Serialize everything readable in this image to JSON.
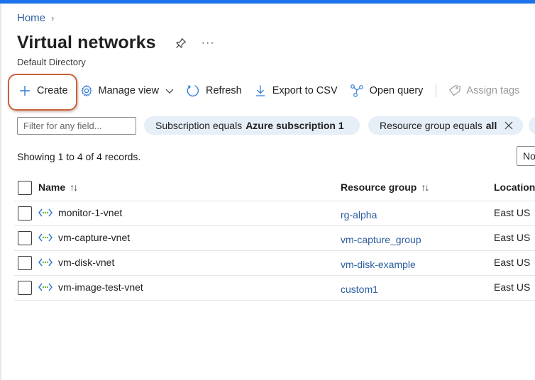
{
  "breadcrumb": {
    "home": "Home",
    "separator": "›"
  },
  "header": {
    "title": "Virtual networks",
    "subtitle": "Default Directory",
    "more": "···"
  },
  "toolbar": {
    "create": "Create",
    "manage_view": "Manage view",
    "refresh": "Refresh",
    "export_csv": "Export to CSV",
    "open_query": "Open query",
    "assign_tags": "Assign tags"
  },
  "filters": {
    "placeholder": "Filter for any field...",
    "subscription_prefix": "Subscription equals",
    "subscription_value": "Azure subscription 1",
    "rg_prefix": "Resource group equals",
    "rg_value": "all"
  },
  "records_text": "Showing 1 to 4 of 4 records.",
  "view_select_partial": "No",
  "table": {
    "columns": {
      "name": "Name",
      "resource_group": "Resource group",
      "location": "Location",
      "sort_glyph": "↑↓"
    },
    "rows": [
      {
        "name": "monitor-1-vnet",
        "resource_group": "rg-alpha",
        "location": "East US"
      },
      {
        "name": "vm-capture-vnet",
        "resource_group": "vm-capture_group",
        "location": "East US"
      },
      {
        "name": "vm-disk-vnet",
        "resource_group": "vm-disk-example",
        "location": "East US"
      },
      {
        "name": "vm-image-test-vnet",
        "resource_group": "custom1",
        "location": "East US"
      }
    ]
  },
  "colors": {
    "accent": "#1a73e8",
    "link": "#2b5d9e",
    "highlight": "#c8623b",
    "pill_bg": "#e6eef8",
    "icon_blue": "#2f7bd8",
    "icon_green": "#6fb93a"
  },
  "icons": {
    "create": "plus-icon",
    "manage_view": "gear-icon",
    "refresh": "refresh-icon",
    "export": "download-icon",
    "open_query": "query-icon",
    "assign_tags": "tag-icon",
    "vnet": "vnet-icon"
  }
}
